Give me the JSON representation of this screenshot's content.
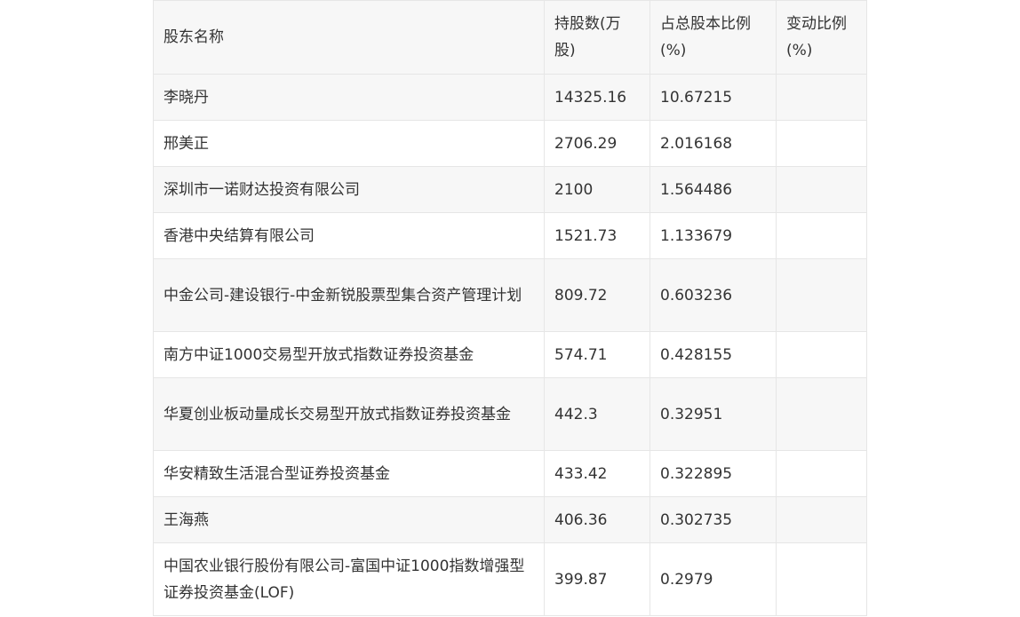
{
  "table": {
    "headers": [
      "股东名称",
      "持股数(万股)",
      "占总股本比例(%)",
      "变动比例(%)"
    ],
    "rows": [
      {
        "name": "李晓丹",
        "shares": "14325.16",
        "ratio": "10.67215",
        "change": ""
      },
      {
        "name": "邢美正",
        "shares": "2706.29",
        "ratio": "2.016168",
        "change": ""
      },
      {
        "name": "深圳市一诺财达投资有限公司",
        "shares": "2100",
        "ratio": "1.564486",
        "change": ""
      },
      {
        "name": "香港中央结算有限公司",
        "shares": "1521.73",
        "ratio": "1.133679",
        "change": ""
      },
      {
        "name": "中金公司-建设银行-中金新锐股票型集合资产管理计划",
        "shares": "809.72",
        "ratio": "0.603236",
        "change": ""
      },
      {
        "name": "南方中证1000交易型开放式指数证券投资基金",
        "shares": "574.71",
        "ratio": "0.428155",
        "change": ""
      },
      {
        "name": "华夏创业板动量成长交易型开放式指数证券投资基金",
        "shares": "442.3",
        "ratio": "0.32951",
        "change": ""
      },
      {
        "name": "华安精致生活混合型证券投资基金",
        "shares": "433.42",
        "ratio": "0.322895",
        "change": ""
      },
      {
        "name": "王海燕",
        "shares": "406.36",
        "ratio": "0.302735",
        "change": ""
      },
      {
        "name": "中国农业银行股份有限公司-富国中证1000指数增强型证券投资基金(LOF)",
        "shares": "399.87",
        "ratio": "0.2979",
        "change": ""
      }
    ]
  }
}
